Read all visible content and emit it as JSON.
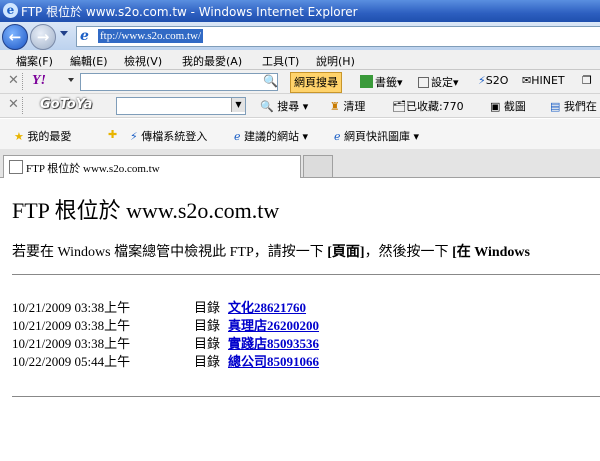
{
  "window": {
    "title": "FTP 根位於 www.s2o.com.tw - Windows Internet Explorer"
  },
  "address": {
    "url": "ftp://www.s2o.com.tw/"
  },
  "menu": [
    "檔案(F)",
    "編輯(E)",
    "檢視(V)",
    "我的最愛(A)",
    "工具(T)",
    "說明(H)"
  ],
  "yahoo_bar": {
    "logo": "Y!",
    "search_button": "網頁搜尋",
    "books": "書籤",
    "settings": "設定",
    "s2o": "S2O",
    "hinet": "HINET"
  },
  "gotoya_bar": {
    "logo": "GoToYa",
    "search": "搜尋",
    "clear": "清理",
    "bookmarked": "已收藏:770",
    "screenshot": "截圖",
    "ours": "我們在"
  },
  "favorites_bar": {
    "favorites": "我的最愛",
    "fax_login": "傳檔系統登入",
    "suggested_sites": "建議的網站",
    "web_slice": "網頁快訊圖庫"
  },
  "tab": {
    "label": "FTP 根位於 www.s2o.com.tw"
  },
  "page": {
    "heading": "FTP 根位於 www.s2o.com.tw",
    "instruction_prefix": "若要在 Windows 檔案總管中檢視此 FTP，請按一下 ",
    "instruction_bold1": "[頁面]",
    "instruction_mid": "，然後按一下 ",
    "instruction_bold2": "[在 Windows",
    "entries": [
      {
        "date": "10/21/2009  03:38上午",
        "kind": "目錄",
        "name": "文化28621760"
      },
      {
        "date": "10/21/2009  03:38上午",
        "kind": "目錄",
        "name": "真理店26200200"
      },
      {
        "date": "10/21/2009  03:38上午",
        "kind": "目錄",
        "name": "實踐店85093536"
      },
      {
        "date": "10/22/2009  05:44上午",
        "kind": "目錄",
        "name": "總公司85091066"
      }
    ]
  }
}
